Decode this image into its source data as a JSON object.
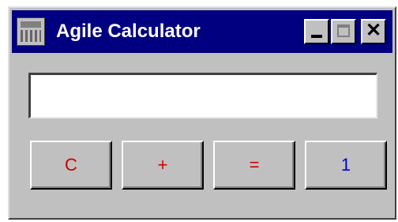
{
  "window": {
    "title": "Agile Calculator",
    "controls": {
      "minimize_icon": "minimize-icon",
      "maximize_icon": "maximize-icon",
      "close_glyph": "✕"
    }
  },
  "display": {
    "value": "",
    "placeholder": ""
  },
  "buttons": [
    {
      "label": "C",
      "color": "#cc0000"
    },
    {
      "label": "+",
      "color": "#cc0000"
    },
    {
      "label": "=",
      "color": "#cc0000"
    },
    {
      "label": "1",
      "color": "#0000cc"
    }
  ],
  "colors": {
    "titlebar": "#000080",
    "face": "#c0c0c0",
    "operator_text": "#cc0000",
    "digit_text": "#0000cc"
  }
}
